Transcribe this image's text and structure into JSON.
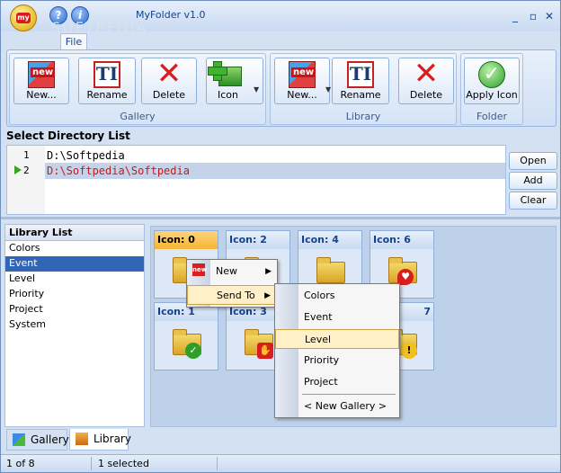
{
  "window": {
    "title": "MyFolder v1.0",
    "watermark": "SOFTPEDIA",
    "file_tab": "File"
  },
  "quick_access": {
    "help": "?",
    "info": "i"
  },
  "controls": {
    "minimize": "_",
    "restore": "▫",
    "close": "✕"
  },
  "ribbon": {
    "groups": [
      {
        "label": "Gallery",
        "buttons": [
          {
            "label": "New...",
            "icon": "new-icon"
          },
          {
            "label": "Rename",
            "icon": "rename-icon"
          },
          {
            "label": "Delete",
            "icon": "delete-icon"
          },
          {
            "label": "Icon",
            "icon": "add-icon-icon"
          }
        ]
      },
      {
        "label": "Library",
        "buttons": [
          {
            "label": "New...",
            "icon": "new-icon"
          },
          {
            "label": "Rename",
            "icon": "rename-icon"
          },
          {
            "label": "Delete",
            "icon": "delete-icon"
          }
        ]
      },
      {
        "label": "Folder",
        "buttons": [
          {
            "label": "Apply Icon",
            "icon": "apply-icon"
          }
        ]
      }
    ]
  },
  "directory": {
    "header": "Select Directory List",
    "lines": [
      {
        "num": "1",
        "path": "D:\\Softpedia"
      },
      {
        "num": "2",
        "path": "D:\\Softpedia\\Softpedia"
      }
    ],
    "selected_index": 1,
    "buttons": {
      "open": "Open",
      "add": "Add",
      "clear": "Clear"
    },
    "colors": {
      "selected_text": "#c81818",
      "arrow": "#3aa323"
    }
  },
  "library": {
    "header": "Library List",
    "items": [
      "Colors",
      "Event",
      "Level",
      "Priority",
      "Project",
      "System"
    ],
    "selected": "Event"
  },
  "icons": {
    "tiles": [
      "Icon: 0",
      "Icon: 1",
      "Icon: 2",
      "Icon: 3",
      "Icon: 4",
      "Icon: 6",
      "7"
    ],
    "active": "Icon: 0"
  },
  "context_menu": {
    "items": [
      "New",
      "Send To"
    ],
    "submenu": [
      "Colors",
      "Event",
      "Level",
      "Priority",
      "Project",
      "< New Gallery >"
    ],
    "highlighted": "Level"
  },
  "bottom_tabs": [
    "Gallery",
    "Library"
  ],
  "status": {
    "page": "1 of 8",
    "selection": "1 selected"
  }
}
